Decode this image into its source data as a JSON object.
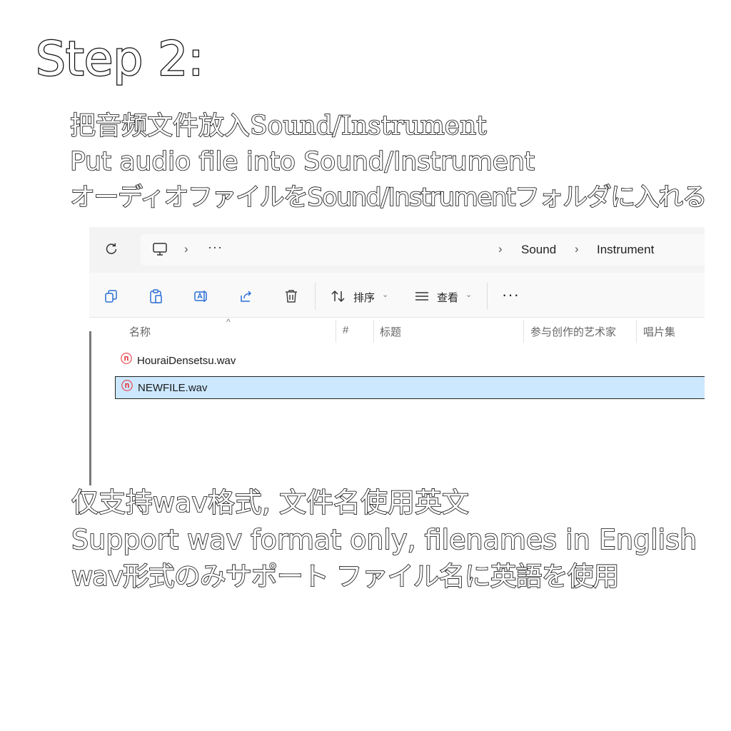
{
  "step_title": "Step 2:",
  "instructions": [
    "把音频文件放入Sound/Instrument",
    "Put audio file into Sound/Instrument",
    "オーディオファイルをSound/Instrumentフォルダに入れる"
  ],
  "explorer": {
    "address": {
      "more": "···",
      "breadcrumbs": [
        "Sound",
        "Instrument"
      ]
    },
    "toolbar": {
      "sort_label": "排序",
      "view_label": "查看",
      "more": "···"
    },
    "columns": [
      "名称",
      "#",
      "标题",
      "参与创作的艺术家",
      "唱片集"
    ],
    "files": [
      {
        "name": "HouraiDensetsu.wav",
        "selected": false
      },
      {
        "name": "NEWFILE.wav",
        "selected": true
      }
    ],
    "colors": {
      "selection": "#cce8ff",
      "file_icon": "#e8424a"
    },
    "icons": [
      "refresh-icon",
      "computer-icon",
      "copy-icon",
      "paste-icon",
      "rename-icon",
      "share-icon",
      "delete-icon",
      "sort-icon",
      "view-icon"
    ]
  },
  "notes": [
    "仅支持wav格式, 文件名使用英文",
    "Support wav format only, filenames in English",
    "wav形式のみサポート ファイル名に英語を使用"
  ]
}
